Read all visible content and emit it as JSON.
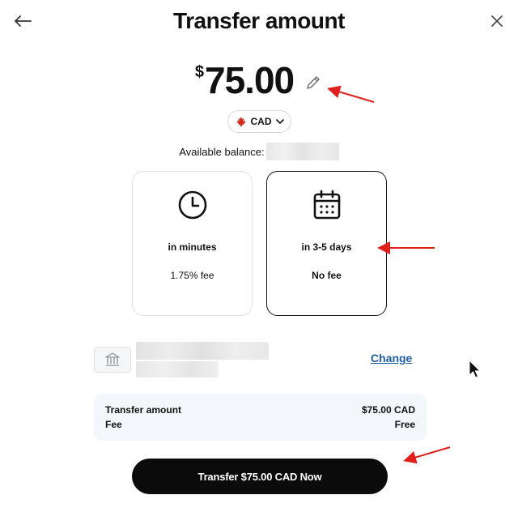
{
  "header": {
    "title": "Transfer amount",
    "back_icon": "arrow-left-icon",
    "close_icon": "close-icon"
  },
  "amount": {
    "currency_symbol": "$",
    "value": "75.00",
    "edit_icon": "pencil-icon"
  },
  "currency": {
    "code": "CAD",
    "flag_icon": "canada-maple-leaf-icon",
    "dropdown_icon": "chevron-down-icon"
  },
  "balance": {
    "label": "Available balance:"
  },
  "options": [
    {
      "icon": "clock-icon",
      "speed": "in minutes",
      "fee": "1.75% fee",
      "selected": false
    },
    {
      "icon": "calendar-icon",
      "speed": "in 3-5 days",
      "fee": "No fee",
      "selected": true
    }
  ],
  "account": {
    "icon": "bank-icon",
    "change_label": "Change"
  },
  "summary": {
    "rows": [
      {
        "label": "Transfer amount",
        "value": "$75.00 CAD"
      },
      {
        "label": "Fee",
        "value": "Free"
      }
    ]
  },
  "primary_button": {
    "label": "Transfer $75.00 CAD Now"
  },
  "colors": {
    "accent_link": "#1f5fa8",
    "button_bg": "#0b0b0b",
    "annotation_arrow": "#e0201b",
    "flag_red": "#d52b1e",
    "summary_bg": "#f3f6fb"
  }
}
